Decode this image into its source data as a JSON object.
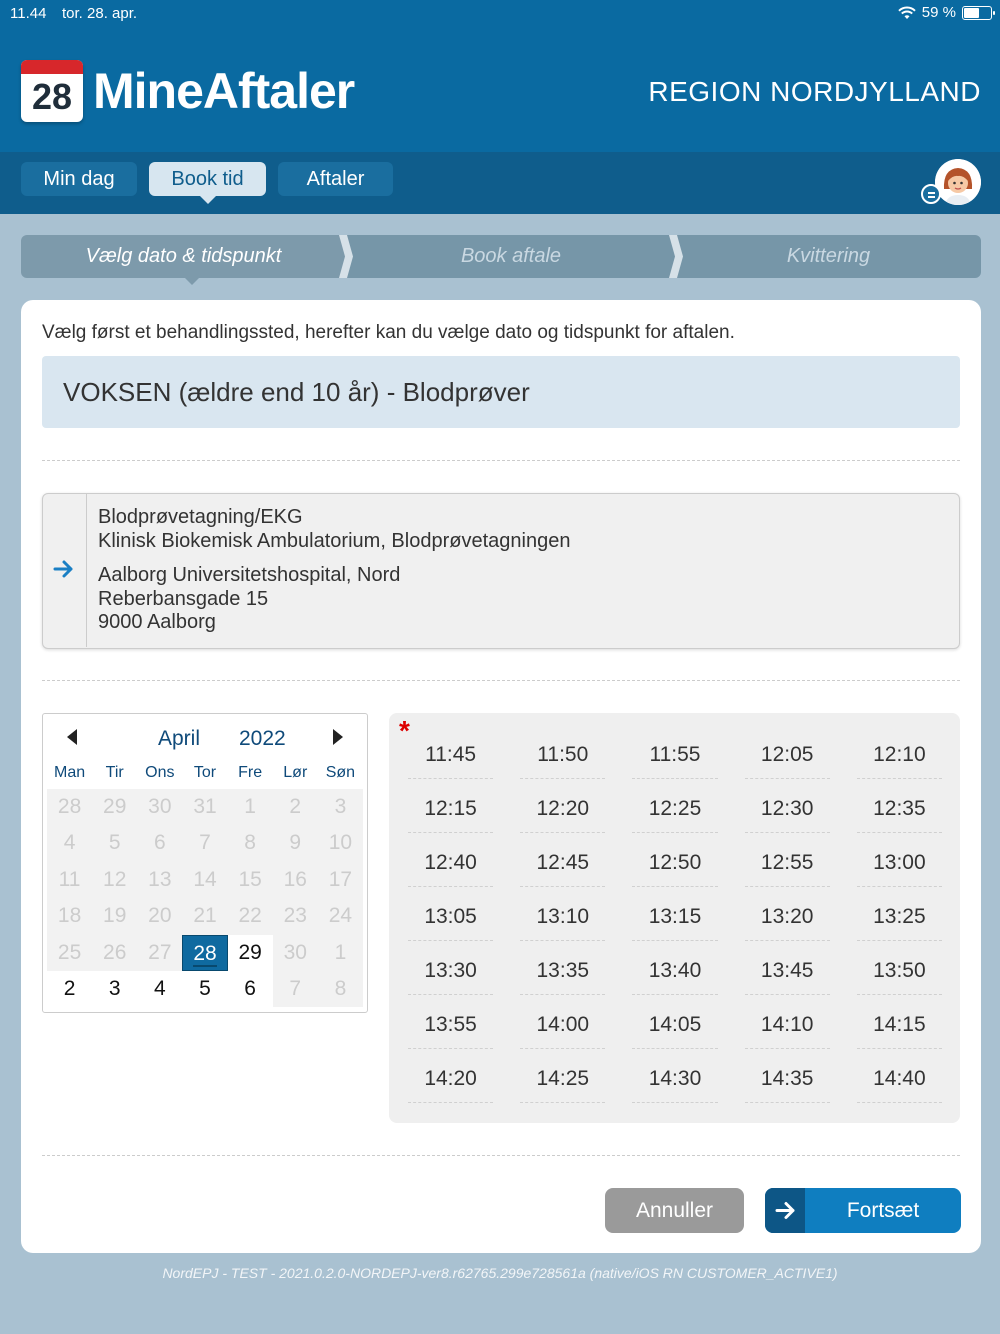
{
  "status_bar": {
    "time": "11.44",
    "date": "tor. 28. apr.",
    "battery": "59 %",
    "battery_level": 0.59
  },
  "header": {
    "logo_day": "28",
    "app_name": "MineAftaler",
    "region": "REGION NORDJYLLAND"
  },
  "nav": {
    "tabs": [
      {
        "label": "Min dag",
        "active": false
      },
      {
        "label": "Book tid",
        "active": true
      },
      {
        "label": "Aftaler",
        "active": false
      }
    ]
  },
  "steps": [
    {
      "label": "Vælg dato & tidspunkt",
      "active": true
    },
    {
      "label": "Book aftale",
      "active": false
    },
    {
      "label": "Kvittering",
      "active": false
    }
  ],
  "main": {
    "intro": "Vælg først et behandlingssted, herefter kan du vælge dato og tidspunkt for aftalen.",
    "service": "VOKSEN (ældre end 10 år) - Blodprøver",
    "location": {
      "line1": "Blodprøvetagning/EKG",
      "line2": "Klinisk Biokemisk Ambulatorium, Blodprøvetagningen",
      "line3": "Aalborg Universitetshospital, Nord",
      "line4": "Reberbansgade 15",
      "line5": "9000 Aalborg"
    }
  },
  "calendar": {
    "month": "April",
    "year": "2022",
    "weekdays": [
      "Man",
      "Tir",
      "Ons",
      "Tor",
      "Fre",
      "Lør",
      "Søn"
    ],
    "weeks": [
      [
        "28",
        "29",
        "30",
        "31",
        "1",
        "2",
        "3"
      ],
      [
        "4",
        "5",
        "6",
        "7",
        "8",
        "9",
        "10"
      ],
      [
        "11",
        "12",
        "13",
        "14",
        "15",
        "16",
        "17"
      ],
      [
        "18",
        "19",
        "20",
        "21",
        "22",
        "23",
        "24"
      ],
      [
        "25",
        "26",
        "27",
        "28",
        "29",
        "30",
        "1"
      ],
      [
        "2",
        "3",
        "4",
        "5",
        "6",
        "7",
        "8"
      ]
    ],
    "selected": "28",
    "available": [
      "28 (apr)",
      "29 (apr)",
      "2 (maj)",
      "3 (maj)",
      "4 (maj)",
      "5 (maj)",
      "6 (maj)"
    ]
  },
  "times": {
    "slots": [
      "11:45",
      "11:50",
      "11:55",
      "12:05",
      "12:10",
      "12:15",
      "12:20",
      "12:25",
      "12:30",
      "12:35",
      "12:40",
      "12:45",
      "12:50",
      "12:55",
      "13:00",
      "13:05",
      "13:10",
      "13:15",
      "13:20",
      "13:25",
      "13:30",
      "13:35",
      "13:40",
      "13:45",
      "13:50",
      "13:55",
      "14:00",
      "14:05",
      "14:10",
      "14:15",
      "14:20",
      "14:25",
      "14:30",
      "14:35",
      "14:40"
    ]
  },
  "buttons": {
    "cancel": "Annuller",
    "continue": "Fortsæt"
  },
  "footer": "NordEPJ - TEST - 2021.0.2.0-NORDEPJ-ver8.r62765.299e728561a (native/iOS RN CUSTOMER_ACTIVE1)",
  "colors": {
    "header": "#0a6aa1",
    "navbar": "#0f5d8c",
    "accent": "#0f7ec0",
    "background": "#a9c1d1"
  }
}
